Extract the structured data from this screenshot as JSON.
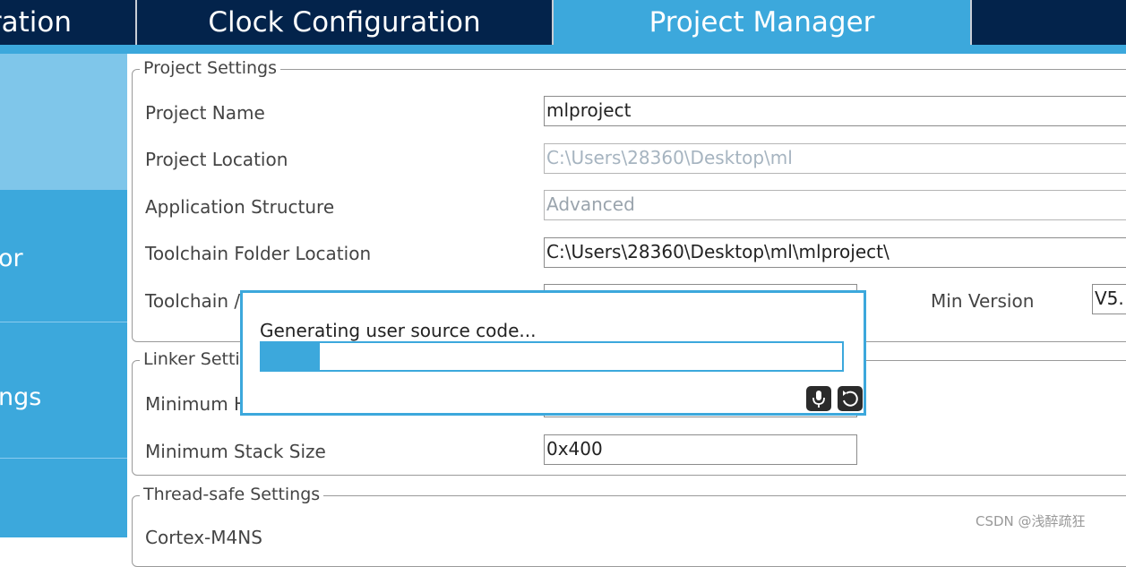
{
  "tabs": {
    "left_partial": "ration",
    "clock": "Clock Configuration",
    "project_manager": "Project Manager"
  },
  "sidebar": {
    "item2_partial": "or",
    "item3_partial": "ngs"
  },
  "project_settings": {
    "title": "Project Settings",
    "project_name_label": "Project Name",
    "project_name_value": "mlproject",
    "project_location_label": "Project Location",
    "project_location_value": "C:\\Users\\28360\\Desktop\\ml",
    "app_structure_label": "Application Structure",
    "app_structure_value": "Advanced",
    "toolchain_folder_label": "Toolchain Folder Location",
    "toolchain_folder_value": "C:\\Users\\28360\\Desktop\\ml\\mlproject\\",
    "toolchain_ide_label_partial": "Toolchain /",
    "min_version_label": "Min Version",
    "min_version_value": "V5."
  },
  "linker_settings": {
    "title_partial": "Linker Setti",
    "min_heap_label_partial": "Minimum H",
    "min_stack_label": "Minimum Stack Size",
    "min_stack_value": "0x400"
  },
  "thread_safe": {
    "title": "Thread-safe Settings",
    "cortex_label_partial": "Cortex-M4NS"
  },
  "dialog": {
    "message": "Generating user source code...",
    "progress": 0.1,
    "icons": [
      "microphone-icon",
      "refresh-icon"
    ]
  },
  "watermark": "CSDN @浅醉疏狂",
  "colors": {
    "navy": "#03234b",
    "accent_blue": "#3ca8dc",
    "selected_sidebar": "#7fc6ea"
  }
}
